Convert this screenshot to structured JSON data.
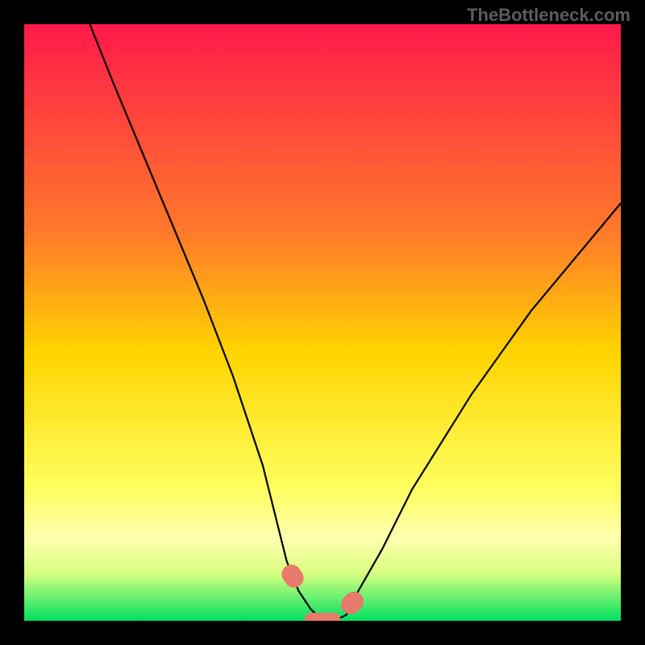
{
  "watermark": "TheBottleneck.com",
  "chart_data": {
    "type": "line",
    "title": "",
    "xlabel": "",
    "ylabel": "",
    "xlim": [
      0,
      100
    ],
    "ylim": [
      0,
      100
    ],
    "gradient_stops": [
      {
        "offset": 0,
        "color": "#ff1a4a"
      },
      {
        "offset": 35,
        "color": "#ff7a2a"
      },
      {
        "offset": 55,
        "color": "#ffd400"
      },
      {
        "offset": 78,
        "color": "#ffff60"
      },
      {
        "offset": 86,
        "color": "#ffffb0"
      },
      {
        "offset": 92,
        "color": "#d8ff80"
      },
      {
        "offset": 100,
        "color": "#00e060"
      }
    ],
    "series": [
      {
        "name": "bottleneck-curve",
        "x": [
          11,
          15,
          20,
          25,
          30,
          35,
          40,
          42,
          44,
          46,
          48,
          50,
          52,
          54,
          56,
          60,
          65,
          70,
          75,
          80,
          85,
          90,
          95,
          100
        ],
        "y": [
          100,
          90,
          78,
          66,
          54,
          41,
          26,
          18,
          10,
          5,
          2,
          0,
          0,
          1,
          5,
          12,
          22,
          30,
          38,
          45,
          52,
          58,
          64,
          70
        ]
      }
    ],
    "markers": [
      {
        "name": "highlight-left",
        "x_range": [
          43,
          47
        ],
        "shape": "capsule",
        "color": "#e77a6a"
      },
      {
        "name": "highlight-right",
        "x_range": [
          53,
          57
        ],
        "shape": "capsule",
        "color": "#e77a6a"
      }
    ]
  }
}
